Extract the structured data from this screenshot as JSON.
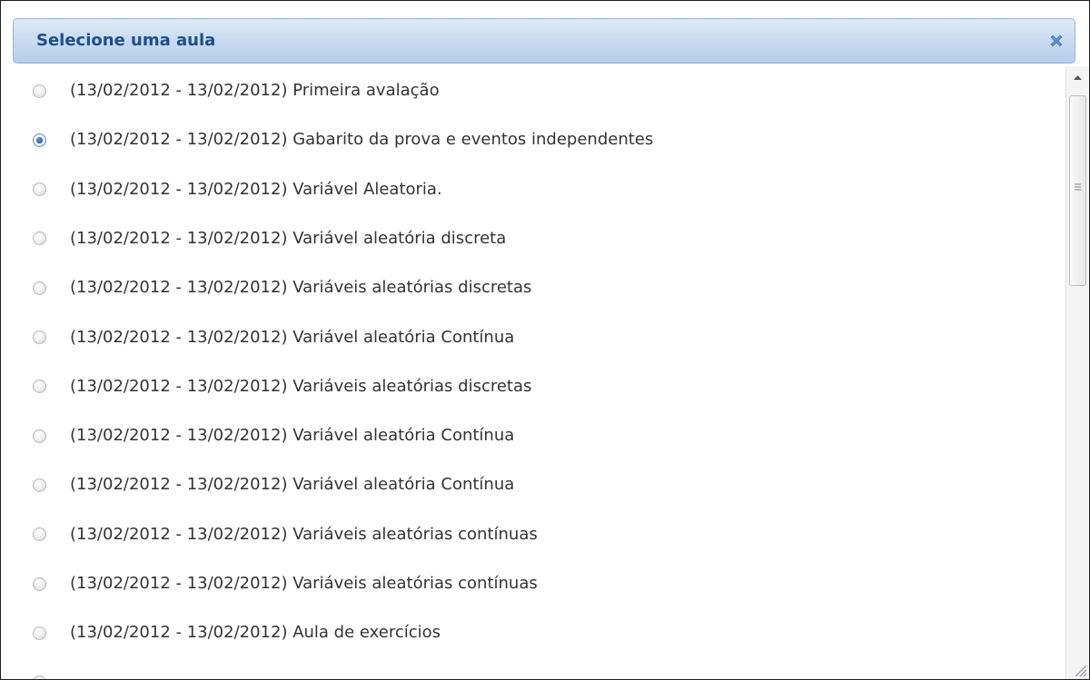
{
  "dialog": {
    "title": "Selecione uma aula",
    "close_icon": "close-x-icon"
  },
  "lessons": [
    {
      "label": "(13/02/2012 - 13/02/2012) Primeira avalação",
      "selected": false
    },
    {
      "label": "(13/02/2012 - 13/02/2012) Gabarito da prova e eventos independentes",
      "selected": true
    },
    {
      "label": "(13/02/2012 - 13/02/2012) Variável Aleatoria.",
      "selected": false
    },
    {
      "label": "(13/02/2012 - 13/02/2012) Variável aleatória discreta",
      "selected": false
    },
    {
      "label": "(13/02/2012 - 13/02/2012) Variáveis aleatórias discretas",
      "selected": false
    },
    {
      "label": "(13/02/2012 - 13/02/2012) Variável aleatória Contínua",
      "selected": false
    },
    {
      "label": "(13/02/2012 - 13/02/2012) Variáveis aleatórias discretas",
      "selected": false
    },
    {
      "label": "(13/02/2012 - 13/02/2012) Variável aleatória Contínua",
      "selected": false
    },
    {
      "label": "(13/02/2012 - 13/02/2012) Variável aleatória Contínua",
      "selected": false
    },
    {
      "label": "(13/02/2012 - 13/02/2012) Variáveis aleatórias contínuas",
      "selected": false
    },
    {
      "label": "(13/02/2012 - 13/02/2012) Variáveis aleatórias contínuas",
      "selected": false
    },
    {
      "label": "(13/02/2012 - 13/02/2012) Aula de exercícios",
      "selected": false
    },
    {
      "label": "",
      "selected": false
    }
  ],
  "colors": {
    "title_text": "#1c4f8a",
    "title_bar": "#c6d9f0",
    "close_icon": "#5b8fd0",
    "item_text": "#333333"
  }
}
